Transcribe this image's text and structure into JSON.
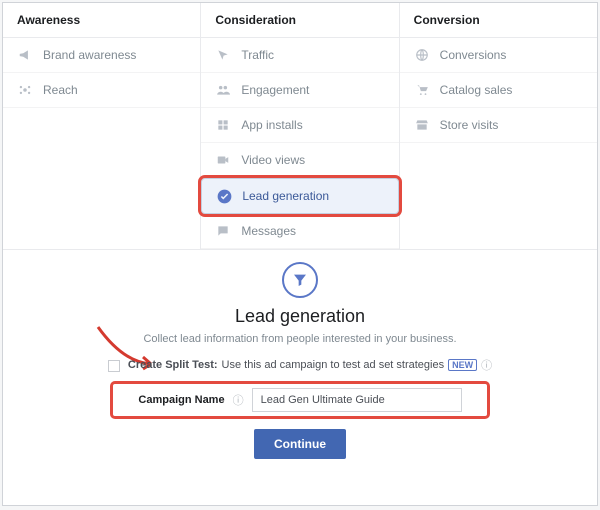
{
  "columns": {
    "awareness": {
      "header": "Awareness",
      "items": [
        "Brand awareness",
        "Reach"
      ]
    },
    "consideration": {
      "header": "Consideration",
      "items": [
        "Traffic",
        "Engagement",
        "App installs",
        "Video views",
        "Lead generation",
        "Messages"
      ],
      "selected_index": 4
    },
    "conversion": {
      "header": "Conversion",
      "items": [
        "Conversions",
        "Catalog sales",
        "Store visits"
      ]
    }
  },
  "detail": {
    "title": "Lead generation",
    "subtitle": "Collect lead information from people interested in your business.",
    "split_test_label": "Create Split Test:",
    "split_test_text": "Use this ad campaign to test ad set strategies",
    "new_badge": "NEW",
    "campaign_name_label": "Campaign Name",
    "campaign_name_value": "Lead Gen Ultimate Guide",
    "continue_label": "Continue"
  }
}
